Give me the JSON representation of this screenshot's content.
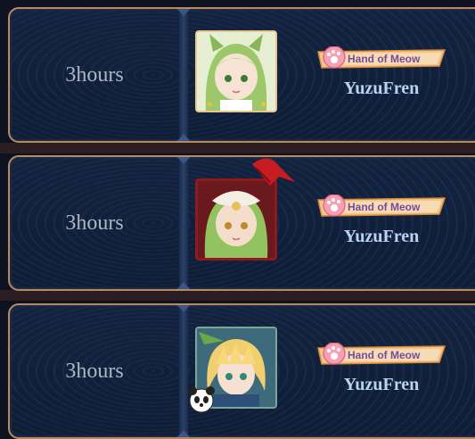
{
  "rows": [
    {
      "duration": "3hours",
      "title_badge": "Hand of Meow",
      "player": "YuzuFren",
      "frame_color": "#e9c58f",
      "avatar": "green-hair-cat-girl-portrait"
    },
    {
      "duration": "3hours",
      "title_badge": "Hand of Meow",
      "player": "YuzuFren",
      "frame_color": "#8e1a1f",
      "avatar": "green-hair-girl-red-bow-portrait"
    },
    {
      "duration": "3hours",
      "title_badge": "Hand of Meow",
      "player": "YuzuFren",
      "frame_color": "#7aa79a",
      "avatar": "blonde-knight-panda-portrait"
    }
  ],
  "colors": {
    "card_border": "#b98a5e",
    "time_text": "#aeb6c4",
    "name_text": "#b8d2f0",
    "badge_orange": "#f0a15a"
  }
}
